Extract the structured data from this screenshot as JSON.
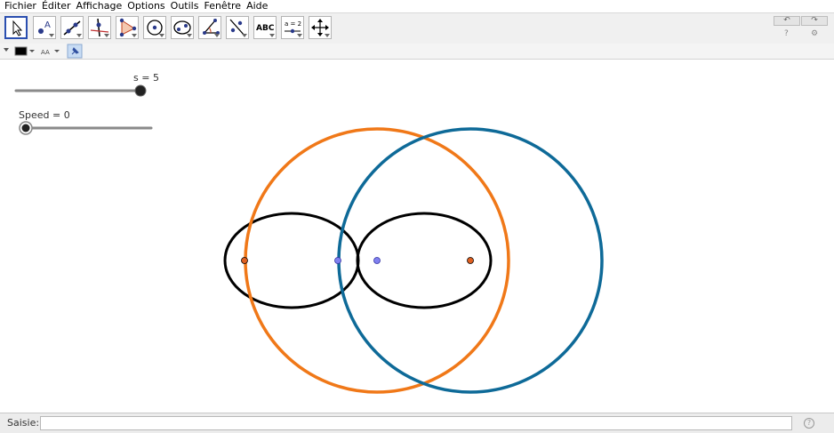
{
  "menu": [
    "Fichier",
    "Éditer",
    "Affichage",
    "Options",
    "Outils",
    "Fenêtre",
    "Aide"
  ],
  "toolbar": {
    "tools": [
      "move-tool",
      "point-tool",
      "line-tool",
      "perpendicular-tool",
      "polygon-tool",
      "circle-tool",
      "conic-tool",
      "angle-tool",
      "reflect-tool",
      "text-tool",
      "slider-tool",
      "move-view-tool"
    ],
    "text_tool_label": "ABC",
    "slider_tool_label": "a = 2",
    "undo_glyph": "↶",
    "redo_glyph": "↷",
    "help_glyph": "?",
    "settings_glyph": "⚙"
  },
  "stylebar": {
    "color": "#000000",
    "font_size_glyph": "AA"
  },
  "sliders": {
    "s": {
      "label": "s = 5",
      "value": 5,
      "min": 0,
      "max": 5
    },
    "speed": {
      "label": "Speed = 0",
      "value": 0,
      "min": 0,
      "max": 5
    }
  },
  "colors": {
    "orange": "#f07818",
    "blue": "#0e6a98",
    "black": "#000000",
    "point_violet": "#8080f0",
    "point_orange": "#e06020"
  },
  "inputbar": {
    "label": "Saisie:",
    "value": "",
    "help_glyph": "?"
  }
}
